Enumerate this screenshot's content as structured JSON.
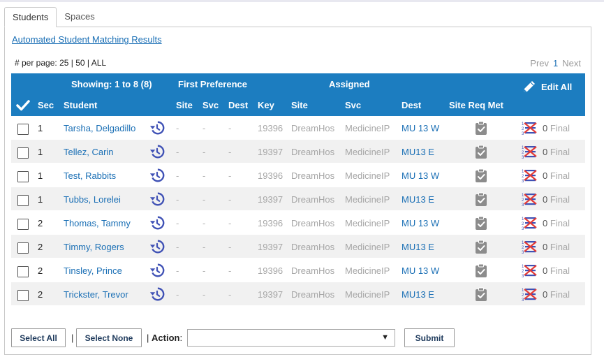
{
  "tabs": [
    {
      "label": "Students",
      "active": true
    },
    {
      "label": "Spaces",
      "active": false
    }
  ],
  "results_link": "Automated Student Matching Results",
  "per_page": {
    "label": "# per page:",
    "options": [
      "25",
      "50",
      "ALL"
    ]
  },
  "pager": {
    "prev": "Prev",
    "current": "1",
    "next": "Next"
  },
  "header": {
    "showing": "Showing: 1 to 8 (8)",
    "first_preference": "First Preference",
    "assigned": "Assigned",
    "edit_all": "Edit All",
    "columns": {
      "sec": "Sec",
      "student": "Student",
      "pref_site": "Site",
      "pref_svc": "Svc",
      "pref_dest": "Dest",
      "key": "Key",
      "site": "Site",
      "svc": "Svc",
      "dest": "Dest",
      "site_req_met": "Site Req Met"
    }
  },
  "rows": [
    {
      "sec": "1",
      "student": "Tarsha, Delgadillo",
      "pref_site": "-",
      "pref_svc": "-",
      "pref_dest": "-",
      "key": "19396",
      "site": "DreamHos",
      "svc": "MedicineIP",
      "dest": "MU 13 W",
      "final_count": "0",
      "final_label": "Final"
    },
    {
      "sec": "1",
      "student": "Tellez, Carin",
      "pref_site": "-",
      "pref_svc": "-",
      "pref_dest": "-",
      "key": "19397",
      "site": "DreamHos",
      "svc": "MedicineIP",
      "dest": "MU13 E",
      "final_count": "0",
      "final_label": "Final"
    },
    {
      "sec": "1",
      "student": "Test, Rabbits",
      "pref_site": "-",
      "pref_svc": "-",
      "pref_dest": "-",
      "key": "19396",
      "site": "DreamHos",
      "svc": "MedicineIP",
      "dest": "MU 13 W",
      "final_count": "0",
      "final_label": "Final"
    },
    {
      "sec": "1",
      "student": "Tubbs, Lorelei",
      "pref_site": "-",
      "pref_svc": "-",
      "pref_dest": "-",
      "key": "19397",
      "site": "DreamHos",
      "svc": "MedicineIP",
      "dest": "MU13 E",
      "final_count": "0",
      "final_label": "Final"
    },
    {
      "sec": "2",
      "student": "Thomas, Tammy",
      "pref_site": "-",
      "pref_svc": "-",
      "pref_dest": "-",
      "key": "19396",
      "site": "DreamHos",
      "svc": "MedicineIP",
      "dest": "MU 13 W",
      "final_count": "0",
      "final_label": "Final"
    },
    {
      "sec": "2",
      "student": "Timmy, Rogers",
      "pref_site": "-",
      "pref_svc": "-",
      "pref_dest": "-",
      "key": "19397",
      "site": "DreamHos",
      "svc": "MedicineIP",
      "dest": "MU13 E",
      "final_count": "0",
      "final_label": "Final"
    },
    {
      "sec": "2",
      "student": "Tinsley, Prince",
      "pref_site": "-",
      "pref_svc": "-",
      "pref_dest": "-",
      "key": "19396",
      "site": "DreamHos",
      "svc": "MedicineIP",
      "dest": "MU 13 W",
      "final_count": "0",
      "final_label": "Final"
    },
    {
      "sec": "2",
      "student": "Trickster, Trevor",
      "pref_site": "-",
      "pref_svc": "-",
      "pref_dest": "-",
      "key": "19397",
      "site": "DreamHos",
      "svc": "MedicineIP",
      "dest": "MU13 E",
      "final_count": "0",
      "final_label": "Final"
    }
  ],
  "footer": {
    "select_all": "Select All",
    "select_none": "Select None",
    "separator": "|",
    "action_separator": "|",
    "action_label": "Action",
    "action_colon": ":",
    "action_value": "",
    "submit": "Submit"
  },
  "colors": {
    "header_blue": "#1c7dc0",
    "link_blue": "#1a6fb5",
    "history_icon": "#3f51b5",
    "clipboard_icon": "#8c8c8c"
  }
}
